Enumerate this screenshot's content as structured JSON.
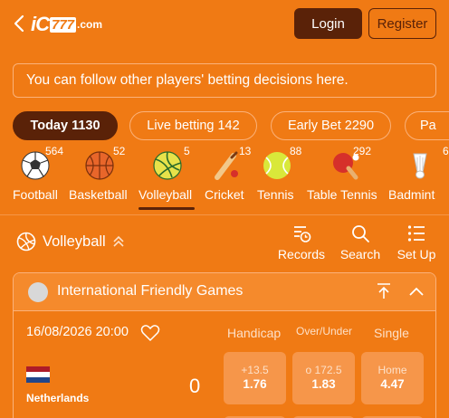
{
  "header": {
    "logo_ic": "iC",
    "logo_num": "777",
    "logo_com": ".com",
    "login_label": "Login",
    "register_label": "Register"
  },
  "notice": "You can follow other players' betting decisions here.",
  "tabs": [
    {
      "label": "Today 1130",
      "active": true
    },
    {
      "label": "Live betting 142",
      "active": false
    },
    {
      "label": "Early Bet 2290",
      "active": false
    },
    {
      "label": "Pa",
      "active": false
    }
  ],
  "sports": [
    {
      "label": "Football",
      "count": "564",
      "icon": "soccer-ball-icon"
    },
    {
      "label": "Basketball",
      "count": "52",
      "icon": "basketball-icon"
    },
    {
      "label": "Volleyball",
      "count": "5",
      "icon": "volleyball-icon",
      "active": true
    },
    {
      "label": "Cricket",
      "count": "13",
      "icon": "cricket-icon"
    },
    {
      "label": "Tennis",
      "count": "88",
      "icon": "tennis-ball-icon"
    },
    {
      "label": "Table Tennis",
      "count": "292",
      "icon": "table-tennis-icon"
    },
    {
      "label": "Badmint",
      "count": "6",
      "icon": "shuttlecock-icon"
    }
  ],
  "section": {
    "title": "Volleyball",
    "tools": [
      {
        "label": "Records",
        "icon": "records-icon"
      },
      {
        "label": "Search",
        "icon": "search-icon"
      },
      {
        "label": "Set Up",
        "icon": "settings-list-icon"
      }
    ]
  },
  "league": {
    "name": "International Friendly Games",
    "match": {
      "datetime": "16/08/2026 20:00",
      "columns": {
        "handicap": "Handicap",
        "over_under": "Over/Under",
        "single": "Single"
      },
      "team": "Netherlands",
      "score": "0",
      "odds": [
        {
          "top": "+13.5",
          "value": "1.76"
        },
        {
          "top": "o 172.5",
          "value": "1.83"
        },
        {
          "top": "Home",
          "value": "4.47"
        }
      ]
    }
  },
  "colors": {
    "background": "#f07a14",
    "dark": "#5a2208",
    "card": "#f6964a"
  }
}
